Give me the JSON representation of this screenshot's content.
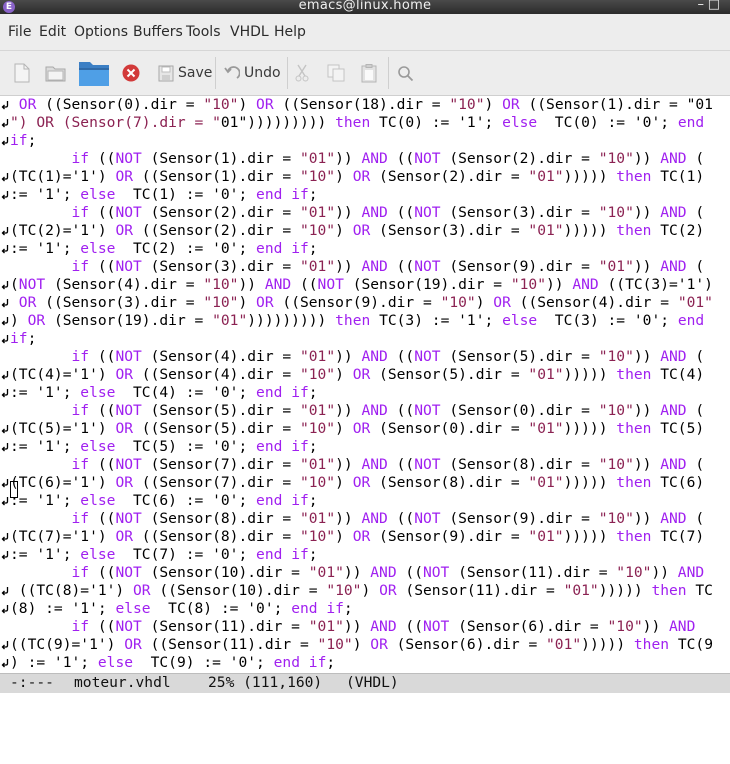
{
  "window": {
    "title": "emacs@linux.home"
  },
  "menu": [
    "File",
    "Edit",
    "Options",
    "Buffers",
    "Tools",
    "VHDL",
    "Help"
  ],
  "toolbar": {
    "save_label": "Save",
    "undo_label": "Undo",
    "icons": [
      "new-file-icon",
      "open-file-icon",
      "open-directory-icon",
      "close-buffer-icon",
      "save-icon",
      "undo-icon",
      "cut-icon",
      "copy-icon",
      "paste-icon",
      "search-icon"
    ]
  },
  "colors": {
    "keyword": "#a020f0",
    "string": "#8b2252",
    "modeline_bg": "#d9d9d9",
    "close_red": "#d23a3a"
  },
  "editor": {
    "lines": [
      {
        "text": " OR ((Sensor(0).dir = \"10\") OR ((Sensor(18).dir = \"10\") OR ((Sensor(1).dir = \"01",
        "cont": true
      },
      {
        "text": "\") OR (Sensor(7).dir = \"01\"))))))))) then TC(0) := '1'; else  TC(0) := '0'; end",
        "cont": true
      },
      {
        "text": "if;",
        "cont": true
      },
      {
        "text": "       if ((NOT (Sensor(1).dir = \"01\")) AND ((NOT (Sensor(2).dir = \"10\")) AND (",
        "cont": false
      },
      {
        "text": "(TC(1)='1') OR ((Sensor(1).dir = \"10\") OR (Sensor(2).dir = \"01\"))))) then TC(1)",
        "cont": true
      },
      {
        "text": ":= '1'; else  TC(1) := '0'; end if;",
        "cont": true
      },
      {
        "text": "       if ((NOT (Sensor(2).dir = \"01\")) AND ((NOT (Sensor(3).dir = \"10\")) AND (",
        "cont": false
      },
      {
        "text": "(TC(2)='1') OR ((Sensor(2).dir = \"10\") OR (Sensor(3).dir = \"01\"))))) then TC(2)",
        "cont": true
      },
      {
        "text": ":= '1'; else  TC(2) := '0'; end if;",
        "cont": true
      },
      {
        "text": "       if ((NOT (Sensor(3).dir = \"01\")) AND ((NOT (Sensor(9).dir = \"01\")) AND (",
        "cont": false
      },
      {
        "text": "(NOT (Sensor(4).dir = \"10\")) AND ((NOT (Sensor(19).dir = \"10\")) AND ((TC(3)='1')",
        "cont": true
      },
      {
        "text": " OR ((Sensor(3).dir = \"10\") OR ((Sensor(9).dir = \"10\") OR ((Sensor(4).dir = \"01\"",
        "cont": true
      },
      {
        "text": ") OR (Sensor(19).dir = \"01\"))))))))) then TC(3) := '1'; else  TC(3) := '0'; end",
        "cont": true
      },
      {
        "text": "if;",
        "cont": true
      },
      {
        "text": "       if ((NOT (Sensor(4).dir = \"01\")) AND ((NOT (Sensor(5).dir = \"10\")) AND (",
        "cont": false
      },
      {
        "text": "(TC(4)='1') OR ((Sensor(4).dir = \"10\") OR (Sensor(5).dir = \"01\"))))) then TC(4)",
        "cont": true
      },
      {
        "text": ":= '1'; else  TC(4) := '0'; end if;",
        "cont": true
      },
      {
        "text": "       if ((NOT (Sensor(5).dir = \"01\")) AND ((NOT (Sensor(0).dir = \"10\")) AND (",
        "cont": false
      },
      {
        "text": "(TC(5)='1') OR ((Sensor(5).dir = \"10\") OR (Sensor(0).dir = \"01\"))))) then TC(5)",
        "cont": true
      },
      {
        "text": ":= '1'; else  TC(5) := '0'; end if;",
        "cont": true
      },
      {
        "text": "       if ((NOT (Sensor(7).dir = \"01\")) AND ((NOT (Sensor(8).dir = \"10\")) AND (",
        "cont": false
      },
      {
        "text": "(TC(6)='1') OR ((Sensor(7).dir = \"10\") OR (Sensor(8).dir = \"01\"))))) then TC(6)",
        "cont": true
      },
      {
        "text": ":= '1'; else  TC(6) := '0'; end if;",
        "cont": true
      },
      {
        "text": "       if ((NOT (Sensor(8).dir = \"01\")) AND ((NOT (Sensor(9).dir = \"10\")) AND (",
        "cont": false
      },
      {
        "text": "(TC(7)='1') OR ((Sensor(8).dir = \"10\") OR (Sensor(9).dir = \"01\"))))) then TC(7)",
        "cont": true
      },
      {
        "text": ":= '1'; else  TC(7) := '0'; end if;",
        "cont": true
      },
      {
        "text": "       if ((NOT (Sensor(10).dir = \"01\")) AND ((NOT (Sensor(11).dir = \"10\")) AND",
        "cont": false
      },
      {
        "text": " ((TC(8)='1') OR ((Sensor(10).dir = \"10\") OR (Sensor(11).dir = \"01\"))))) then TC",
        "cont": true
      },
      {
        "text": "(8) := '1'; else  TC(8) := '0'; end if;",
        "cont": true
      },
      {
        "text": "       if ((NOT (Sensor(11).dir = \"01\")) AND ((NOT (Sensor(6).dir = \"10\")) AND",
        "cont": false
      },
      {
        "text": "((TC(9)='1') OR ((Sensor(11).dir = \"10\") OR (Sensor(6).dir = \"01\"))))) then TC(9",
        "cont": true
      },
      {
        "text": ") := '1'; else  TC(9) := '0'; end if;",
        "cont": true
      }
    ]
  },
  "modeline": {
    "status": "-:---",
    "buffer": "moteur.vhdl",
    "position": "25% (111,160)",
    "mode": "(VHDL)"
  }
}
